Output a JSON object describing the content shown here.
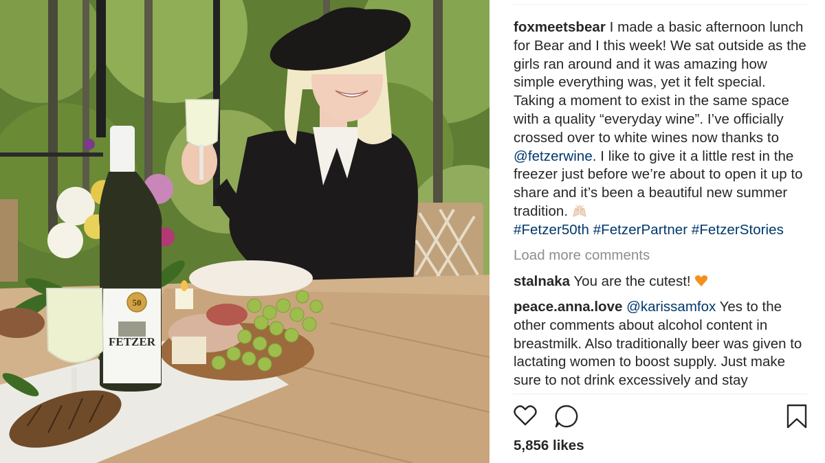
{
  "post": {
    "username": "foxmeetsbear",
    "caption_part1": " I made a basic afternoon lunch for Bear and I this week! We sat outside as the girls ran around and it was amazing how simple everything was, yet it felt special. Taking a moment to exist in the same space with a quality “everyday wine”. I’ve officially crossed over to white wines now thanks to ",
    "caption_mention": "@fetzerwine",
    "caption_part2": ". I like to give it a little rest in the freezer just before we’re about to open it up to share and it’s been a beautiful new summer tradition. ",
    "caption_emoji": "raised-hands-emoji",
    "hashtags": [
      "#Fetzer50th",
      "#FetzerPartner",
      "#FetzerStories"
    ]
  },
  "load_more_label": "Load more comments",
  "comments": [
    {
      "username": "stalnaka",
      "text": " You are the cutest! ",
      "emoji": "orange-heart-emoji"
    },
    {
      "username": "peace.anna.love",
      "mention": "@karissamfox",
      "text": " Yes to the other comments about alcohol content in breastmilk. Also traditionally beer was given to lactating women to boost supply. Just make sure to not drink excessively and stay"
    }
  ],
  "likes": "5,856 likes",
  "icons": {
    "like": "heart-outline-icon",
    "comment": "speech-bubble-icon",
    "save": "bookmark-icon"
  },
  "photo": {
    "bottle_label": "FETZER",
    "bottle_badge": "50"
  }
}
